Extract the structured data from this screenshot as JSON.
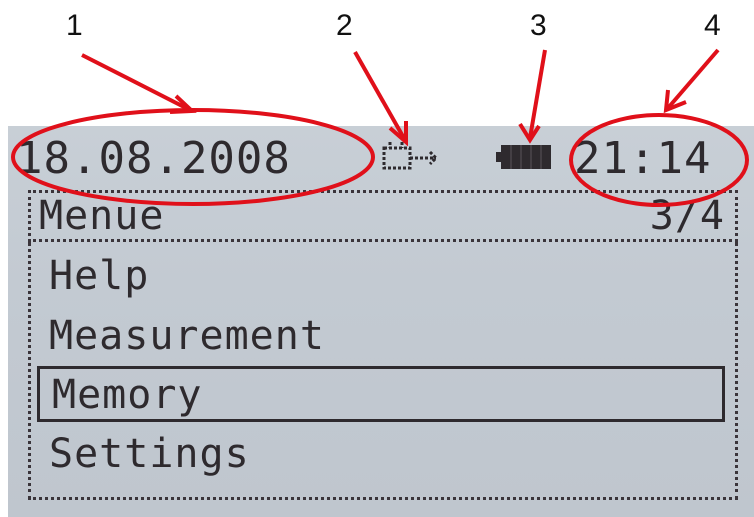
{
  "callouts": {
    "n1": "1",
    "n2": "2",
    "n3": "3",
    "n4": "4"
  },
  "status_bar": {
    "date": "18.08.2008",
    "time": "21:14",
    "power_icon": "plug-power-icon",
    "battery_icon": "battery-full-icon"
  },
  "title_bar": {
    "title": "Menue",
    "page": "3/4"
  },
  "menu": {
    "items": [
      {
        "label": "Help",
        "selected": false
      },
      {
        "label": "Measurement",
        "selected": false
      },
      {
        "label": "Memory",
        "selected": true
      },
      {
        "label": "Settings",
        "selected": false
      }
    ]
  },
  "colors": {
    "lcd_background": "#c3cad2",
    "lcd_text": "#2e2a2e",
    "annotation_red": "#e0101a"
  }
}
